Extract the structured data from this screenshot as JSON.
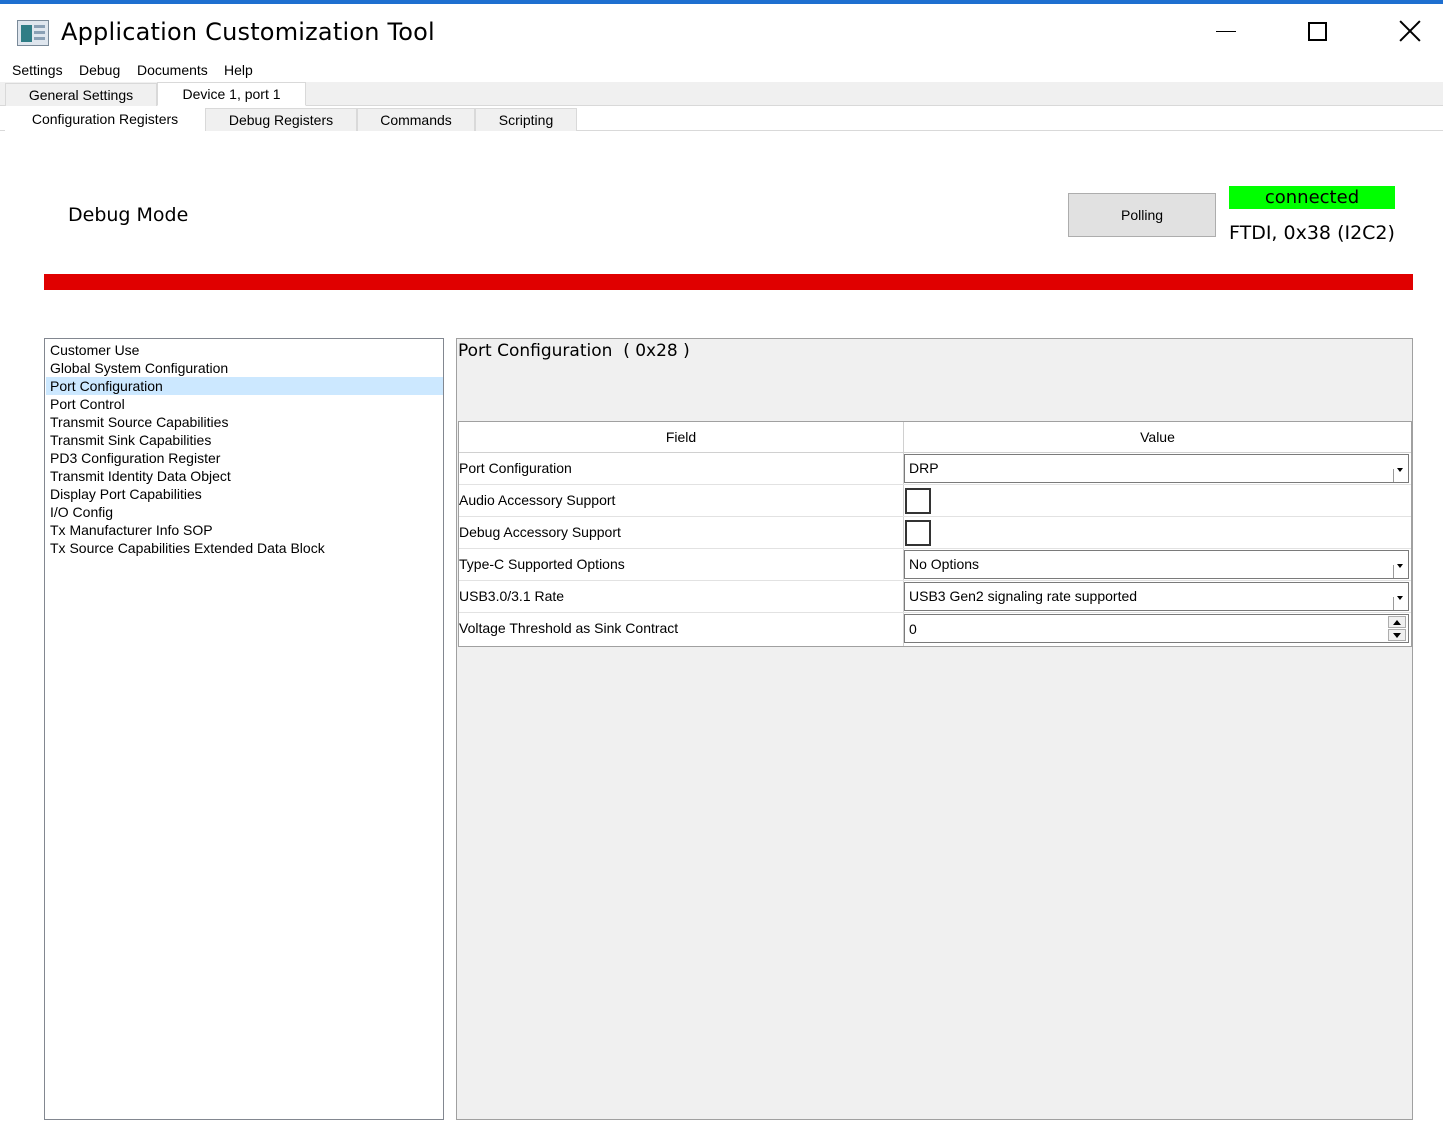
{
  "window": {
    "title": "Application Customization Tool",
    "minimize_icon": "minimize-icon",
    "maximize_icon": "maximize-icon",
    "close_icon": "close-icon"
  },
  "menu": {
    "items": [
      {
        "label": "Settings"
      },
      {
        "label": "Debug"
      },
      {
        "label": "Documents"
      },
      {
        "label": "Help"
      }
    ]
  },
  "top_tabs": [
    {
      "label": "General Settings",
      "active": false
    },
    {
      "label": "Device 1, port 1",
      "active": true
    }
  ],
  "sub_tabs": [
    {
      "label": "Configuration Registers",
      "active": true
    },
    {
      "label": "Debug Registers",
      "active": false
    },
    {
      "label": "Commands",
      "active": false
    },
    {
      "label": "Scripting",
      "active": false
    }
  ],
  "header": {
    "mode_label": "Debug Mode",
    "polling_label": "Polling",
    "status_text": "connected",
    "status_color": "#00ff00",
    "connection_info": "FTDI, 0x38 (I2C2)",
    "alert_bar_color": "#e00000"
  },
  "register_list": {
    "items": [
      {
        "label": "Customer Use",
        "selected": false
      },
      {
        "label": "Global System Configuration",
        "selected": false
      },
      {
        "label": "Port Configuration",
        "selected": true
      },
      {
        "label": "Port Control",
        "selected": false
      },
      {
        "label": "Transmit Source Capabilities",
        "selected": false
      },
      {
        "label": "Transmit Sink Capabilities",
        "selected": false
      },
      {
        "label": "PD3 Configuration Register",
        "selected": false
      },
      {
        "label": "Transmit Identity Data Object",
        "selected": false
      },
      {
        "label": "Display Port Capabilities",
        "selected": false
      },
      {
        "label": "I/O Config",
        "selected": false
      },
      {
        "label": "Tx Manufacturer Info SOP",
        "selected": false
      },
      {
        "label": "Tx Source Capabilities Extended Data Block",
        "selected": false
      }
    ]
  },
  "detail": {
    "title": "Port Configuration  ( 0x28 )",
    "columns": {
      "field": "Field",
      "value": "Value"
    },
    "rows": [
      {
        "field": "Port Configuration",
        "type": "combo",
        "value": "DRP"
      },
      {
        "field": "Audio Accessory Support",
        "type": "checkbox",
        "checked": false
      },
      {
        "field": "Debug Accessory Support",
        "type": "checkbox",
        "checked": false
      },
      {
        "field": "Type-C Supported Options",
        "type": "combo",
        "value": "No Options"
      },
      {
        "field": "USB3.0/3.1 Rate",
        "type": "combo",
        "value": "USB3 Gen2 signaling rate supported"
      },
      {
        "field": "Voltage Threshold as Sink Contract",
        "type": "spin",
        "value": "0"
      }
    ]
  }
}
